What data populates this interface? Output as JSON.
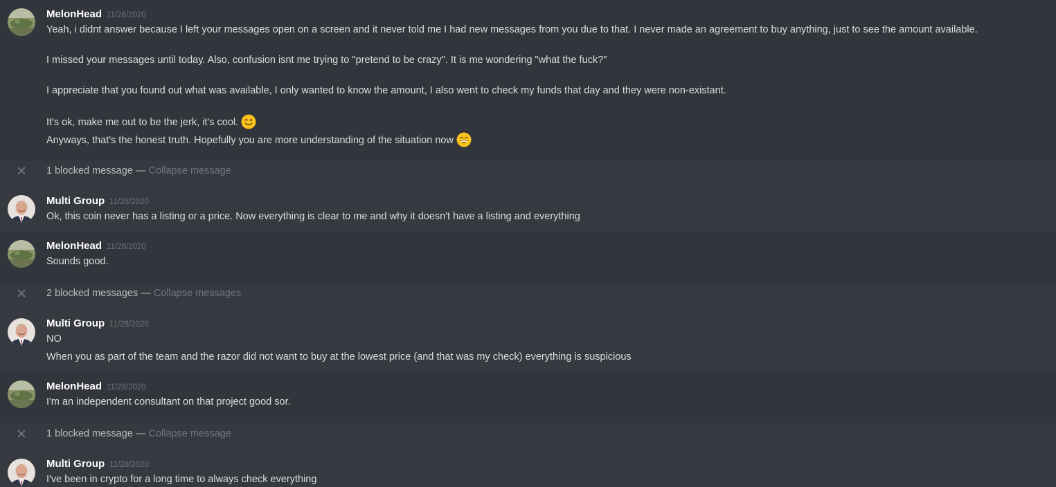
{
  "messages": [
    {
      "author": "MelonHead",
      "timestamp": "11/28/2020",
      "avatar": "frog-avatar",
      "lines": [
        "Yeah, i didnt answer because I left your messages open on a screen and it never told me I had new messages from you due to that. I never made an agreement to buy anything, just to see the amount available.",
        "I missed your messages until today. Also, confusion isnt me trying to \"pretend to be crazy\". It is me wondering \"what the fuck?\"",
        "I appreciate that you found out what was available, I only wanted to know the amount, I also went to check my funds that day and they were non-existant.",
        "It's ok, make me out to be the jerk, it's cool.",
        "Anyways, that's the honest truth. Hopefully you are more understanding of the situation now"
      ],
      "emojis": [
        "wink-emoji",
        "grin-emoji"
      ]
    },
    {
      "author": "Multi Group",
      "timestamp": "11/28/2020",
      "avatar": "man-avatar",
      "lines": [
        "Ok, this coin never has a listing or a price. Now everything is clear to me and why it doesn't have a listing and everything"
      ]
    },
    {
      "author": "MelonHead",
      "timestamp": "11/28/2020",
      "avatar": "frog-avatar",
      "lines": [
        "Sounds good."
      ]
    },
    {
      "author": "Multi Group",
      "timestamp": "11/28/2020",
      "avatar": "man-avatar",
      "lines": [
        "NO",
        "When you as part of the team and the razor did not want to buy at the lowest price (and that was my check) everything is suspicious"
      ]
    },
    {
      "author": "MelonHead",
      "timestamp": "11/28/2020",
      "avatar": "frog-avatar",
      "lines": [
        "I'm an independent consultant on that project good sor."
      ]
    },
    {
      "author": "Multi Group",
      "timestamp": "11/28/2020",
      "avatar": "man-avatar",
      "lines": [
        "I've been in crypto for a long time to always check everything"
      ]
    }
  ],
  "blocked": [
    {
      "count_text": "1 blocked message",
      "separator": "—",
      "collapse_label": "Collapse message"
    },
    {
      "count_text": "2 blocked messages",
      "separator": "—",
      "collapse_label": "Collapse messages"
    },
    {
      "count_text": "1 blocked message",
      "separator": "—",
      "collapse_label": "Collapse message"
    }
  ],
  "colors": {
    "background": "#36393f",
    "hover_background": "#32353b",
    "author": "#ffffff",
    "text": "#dcddde",
    "muted": "#72767d",
    "emoji": "#fcc21b"
  }
}
